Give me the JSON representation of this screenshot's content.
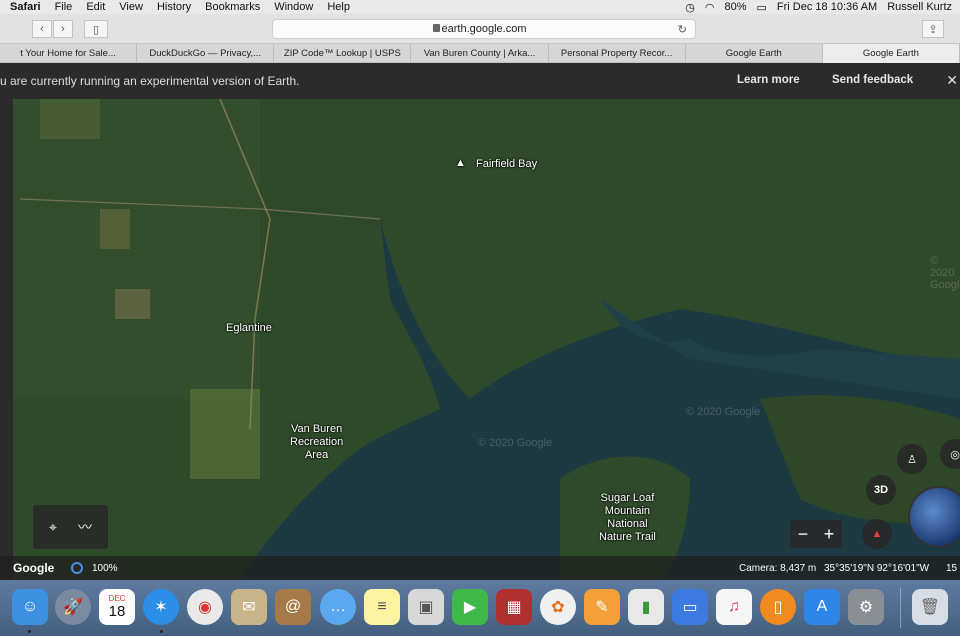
{
  "menubar": {
    "app": "Safari",
    "items": [
      "File",
      "Edit",
      "View",
      "History",
      "Bookmarks",
      "Window",
      "Help"
    ],
    "battery": "80%",
    "datetime": "Fri Dec 18  10:36 AM",
    "user": "Russell Kurtz"
  },
  "toolbar": {
    "address": "earth.google.com"
  },
  "tabs": [
    "t Your Home for Sale...",
    "DuckDuckGo — Privacy,...",
    "ZIP Code™ Lookup | USPS",
    "Van Buren County | Arka...",
    "Personal Property Recor...",
    "Google Earth",
    "Google Earth"
  ],
  "banner": {
    "message": "u are currently running an experimental version of Earth.",
    "learn_more": "Learn more",
    "send_feedback": "Send feedback"
  },
  "map": {
    "labels": {
      "fairfield_bay": "Fairfield Bay",
      "eglantine": "Eglantine",
      "van_buren": "Van Buren\nRecreation\nArea",
      "sugar_loaf": "Sugar Loaf\nMountain\nNational\nNature Trail"
    },
    "watermarks": [
      "© 2020 Google",
      "© 2020 Google",
      "© 2020 Google"
    ],
    "controls": {
      "mode_3d": "3D",
      "zoom_out": "−",
      "zoom_in": "+"
    }
  },
  "statusbar": {
    "brand": "Google",
    "zoom": "100%",
    "camera": "Camera: 8,437 m",
    "coordinates": "35°35'19\"N 92°16'01\"W",
    "elevation": "15"
  },
  "dock": {
    "apps": [
      "finder-icon",
      "launchpad-icon",
      "calendar-icon",
      "safari-icon",
      "chrome-icon",
      "mail-stamp-icon",
      "contacts-icon",
      "messages-icon",
      "notes-icon",
      "preview-icon",
      "facetime-icon",
      "photo-booth-icon",
      "photos-icon",
      "pages-icon",
      "numbers-icon",
      "keynote-icon",
      "music-icon",
      "books-icon",
      "app-store-icon",
      "system-preferences-icon",
      "trash-icon"
    ],
    "calendar_month": "DEC",
    "calendar_day": "18"
  },
  "colors": {
    "water": "#1d3a43",
    "forest": "#2f4a2a",
    "banner": "#2b2b2b",
    "dock": "#5a769a"
  }
}
